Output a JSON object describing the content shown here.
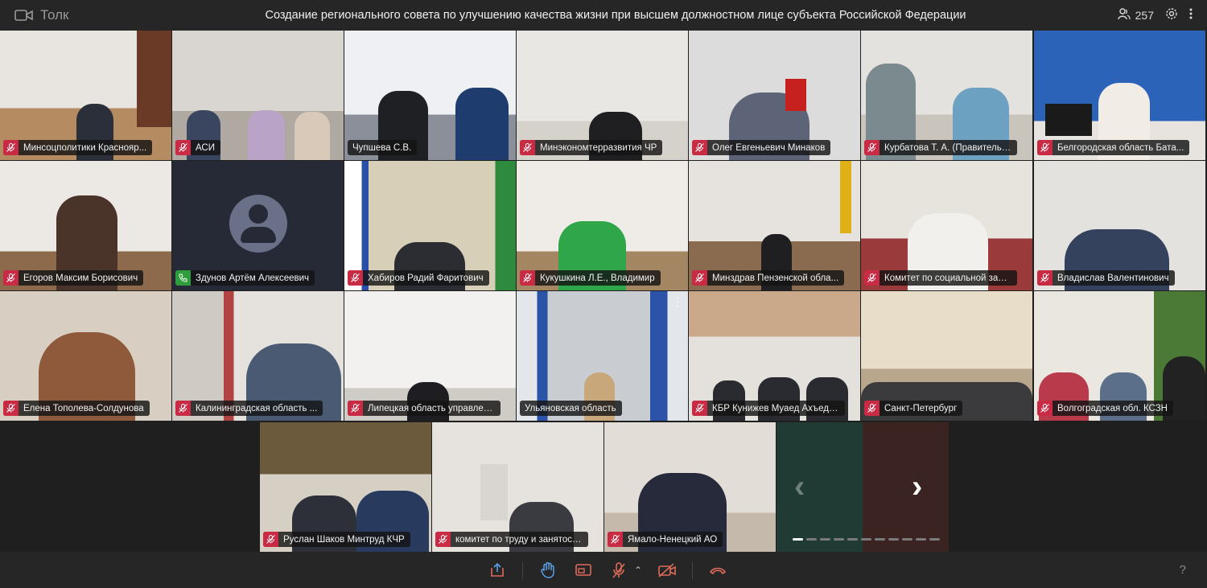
{
  "app": {
    "name": "Толк"
  },
  "meeting": {
    "title": "Создание регионального совета по улучшению качества жизни при высшем должностном лице субъекта Российской Федерации",
    "participant_count": "257"
  },
  "tiles": [
    {
      "label": "Минсоцполитики Краснояр...",
      "mic": "muted"
    },
    {
      "label": "АСИ",
      "mic": "muted"
    },
    {
      "label": "Чупшева С.В.",
      "mic": "none"
    },
    {
      "label": "Минэкономтерразвития ЧР",
      "mic": "muted"
    },
    {
      "label": "Олег Евгеньевич Минаков",
      "mic": "muted"
    },
    {
      "label": "Курбатова Т. А. (Правительс...",
      "mic": "muted"
    },
    {
      "label": "Белгородская область Бата...",
      "mic": "muted"
    },
    {
      "label": "Егоров Максим Борисович",
      "mic": "muted"
    },
    {
      "label": "Здунов Артём Алексеевич",
      "mic": "phone"
    },
    {
      "label": "Хабиров Радий Фаритович",
      "mic": "muted"
    },
    {
      "label": "Кукушкина Л.Е., Владимир",
      "mic": "muted"
    },
    {
      "label": "Минздрав Пензенской обла...",
      "mic": "muted"
    },
    {
      "label": "Комитет по социальной защ...",
      "mic": "muted"
    },
    {
      "label": "Владислав Валентинович",
      "mic": "muted"
    },
    {
      "label": "Елена Тополева-Солдунова",
      "mic": "muted"
    },
    {
      "label": "Калининградская область ...",
      "mic": "muted"
    },
    {
      "label": "Липецкая область управлен...",
      "mic": "muted"
    },
    {
      "label": "Ульяновская область",
      "mic": "none"
    },
    {
      "label": "КБР Кунижев Муаед Ахъедо...",
      "mic": "muted"
    },
    {
      "label": "Санкт-Петербург",
      "mic": "muted"
    },
    {
      "label": "Волгоградская обл. КСЗН",
      "mic": "muted"
    },
    {
      "label": "Руслан Шаков Минтруд КЧР",
      "mic": "muted"
    },
    {
      "label": "комитет по труду и занятост...",
      "mic": "muted"
    },
    {
      "label": "Ямало-Ненецкий АО",
      "mic": "muted"
    }
  ],
  "colors": {
    "accent": "#3d8ae6",
    "muted": "#c92b45",
    "phone": "#2e9e3c"
  },
  "controls": [
    "share-screen",
    "raise-hand",
    "layout",
    "microphone",
    "camera",
    "leave"
  ],
  "help": "?"
}
